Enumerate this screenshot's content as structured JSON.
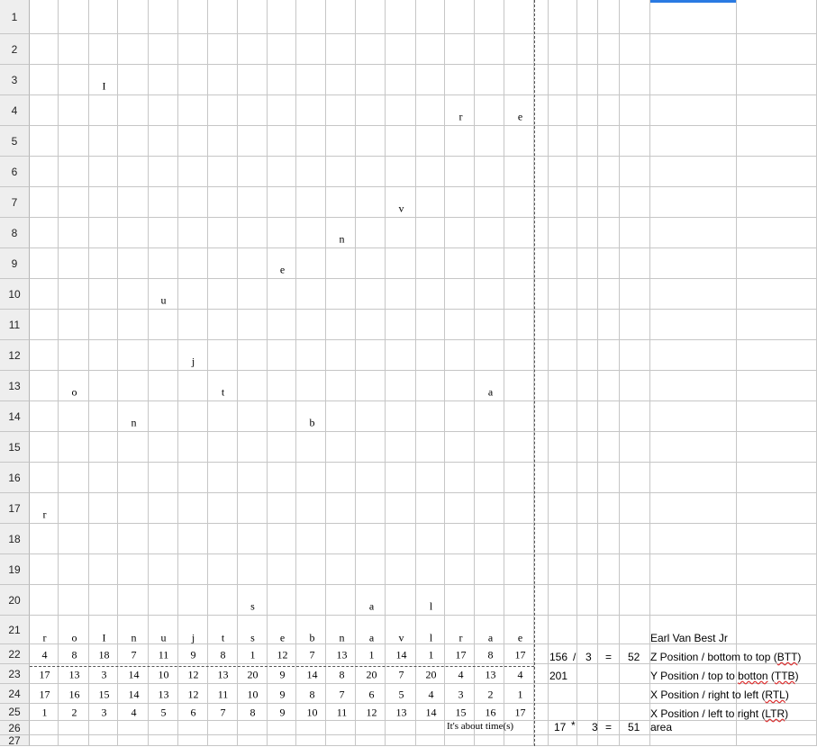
{
  "row_numbers": [
    "1",
    "2",
    "3",
    "4",
    "5",
    "6",
    "7",
    "8",
    "9",
    "10",
    "11",
    "12",
    "13",
    "14",
    "15",
    "16",
    "17",
    "18",
    "19",
    "20",
    "21",
    "22",
    "23",
    "24",
    "25",
    "26",
    "27"
  ],
  "scatter_letters": [
    {
      "ch": "I",
      "col": 3,
      "row": 3
    },
    {
      "ch": "r",
      "col": 15,
      "row": 4
    },
    {
      "ch": "e",
      "col": 17,
      "row": 4
    },
    {
      "ch": "v",
      "col": 13,
      "row": 7
    },
    {
      "ch": "n",
      "col": 11,
      "row": 8
    },
    {
      "ch": "e",
      "col": 9,
      "row": 9
    },
    {
      "ch": "u",
      "col": 5,
      "row": 10
    },
    {
      "ch": "j",
      "col": 6,
      "row": 12
    },
    {
      "ch": "o",
      "col": 2,
      "row": 13
    },
    {
      "ch": "t",
      "col": 7,
      "row": 13
    },
    {
      "ch": "a",
      "col": 16,
      "row": 13
    },
    {
      "ch": "n",
      "col": 4,
      "row": 14
    },
    {
      "ch": "b",
      "col": 10,
      "row": 14
    },
    {
      "ch": "r",
      "col": 1,
      "row": 17
    },
    {
      "ch": "s",
      "col": 8,
      "row": 20
    },
    {
      "ch": "a",
      "col": 12,
      "row": 20
    },
    {
      "ch": "l",
      "col": 14,
      "row": 20
    }
  ],
  "row21_letters": [
    "r",
    "o",
    "I",
    "n",
    "u",
    "j",
    "t",
    "s",
    "e",
    "b",
    "n",
    "a",
    "v",
    "l",
    "r",
    "a",
    "e"
  ],
  "row22_z": [
    "4",
    "8",
    "18",
    "7",
    "11",
    "9",
    "8",
    "1",
    "12",
    "7",
    "13",
    "1",
    "14",
    "1",
    "17",
    "8",
    "17"
  ],
  "row23_y": [
    "17",
    "13",
    "3",
    "14",
    "10",
    "12",
    "13",
    "20",
    "9",
    "14",
    "8",
    "20",
    "7",
    "20",
    "4",
    "13",
    "4"
  ],
  "row24_x_rtl": [
    "17",
    "16",
    "15",
    "14",
    "13",
    "12",
    "11",
    "10",
    "9",
    "8",
    "7",
    "6",
    "5",
    "4",
    "3",
    "2",
    "1"
  ],
  "row25_x_ltr": [
    "1",
    "2",
    "3",
    "4",
    "5",
    "6",
    "7",
    "8",
    "9",
    "10",
    "11",
    "12",
    "13",
    "14",
    "15",
    "16",
    "17"
  ],
  "calc": {
    "r22_a": "156",
    "r22_op": "/",
    "r22_b": "3",
    "r22_eq": "=",
    "r22_res": "52",
    "r23_a": "201",
    "r26_a": "17",
    "r26_op": "*",
    "r26_b": "3",
    "r26_eq": "=",
    "r26_res": "51"
  },
  "labels": {
    "name": "Earl Van Best Jr",
    "z_pre": "Z Position / bottom to top (",
    "z_abbr": "BTT",
    "z_post": ")",
    "y_pre": "Y Position / top to ",
    "y_word": "botton",
    "y_mid": " (",
    "y_abbr": "TTB",
    "y_post": ")",
    "x_rtl_pre": "X Position / right to left (",
    "x_rtl_abbr": "RTL",
    "x_rtl_post": ")",
    "x_ltr_pre": "X Position / left to right (",
    "x_ltr_abbr": "LTR",
    "x_ltr_post": ")",
    "area": "area",
    "about_time": "It's about time(s)"
  },
  "colors": {
    "selection": "#2a7ae2",
    "grid": "#c6c6c6",
    "header_bg": "#eeeeee"
  }
}
